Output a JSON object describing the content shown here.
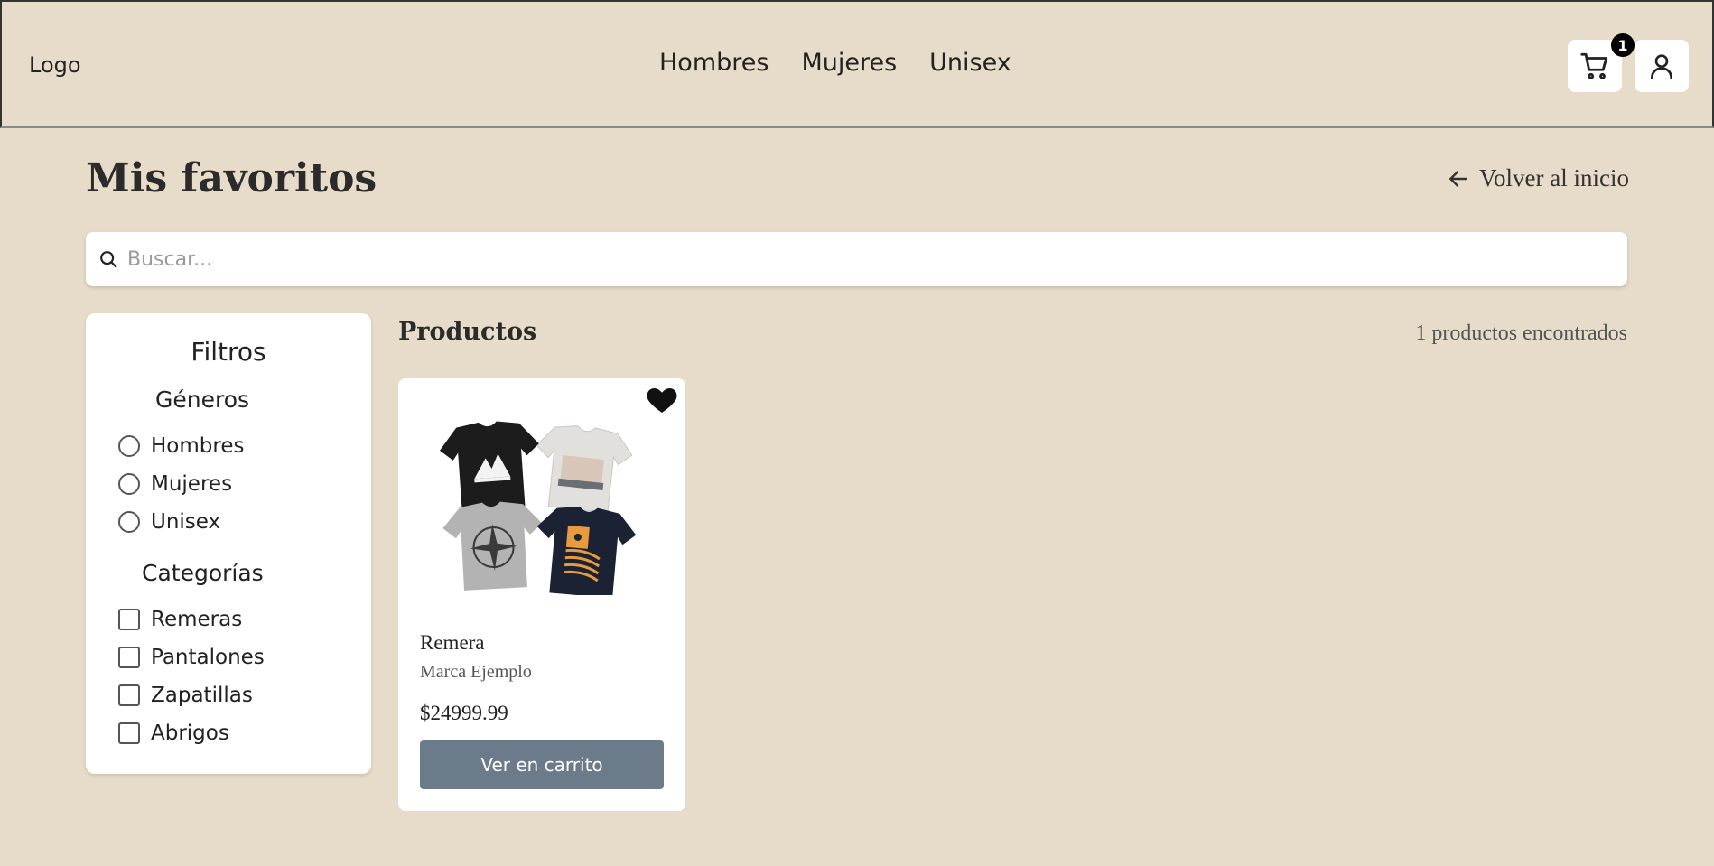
{
  "header": {
    "logo": "Logo",
    "nav": [
      "Hombres",
      "Mujeres",
      "Unisex"
    ],
    "cart_count": "1"
  },
  "page": {
    "title": "Mis favoritos",
    "back_label": "Volver al inicio"
  },
  "search": {
    "placeholder": "Buscar...",
    "value": ""
  },
  "filters": {
    "title": "Filtros",
    "genders_title": "Géneros",
    "genders": [
      "Hombres",
      "Mujeres",
      "Unisex"
    ],
    "categories_title": "Categorías",
    "categories": [
      "Remeras",
      "Pantalones",
      "Zapatillas",
      "Abrigos"
    ]
  },
  "products": {
    "title": "Productos",
    "count_text": "1 productos encontrados",
    "items": [
      {
        "name": "Remera",
        "brand": "Marca Ejemplo",
        "price": "$24999.99",
        "button": "Ver en carrito",
        "favorite": true
      }
    ]
  },
  "colors": {
    "background": "#e7dcc9",
    "button": "#6c7b89",
    "card": "#ffffff"
  }
}
